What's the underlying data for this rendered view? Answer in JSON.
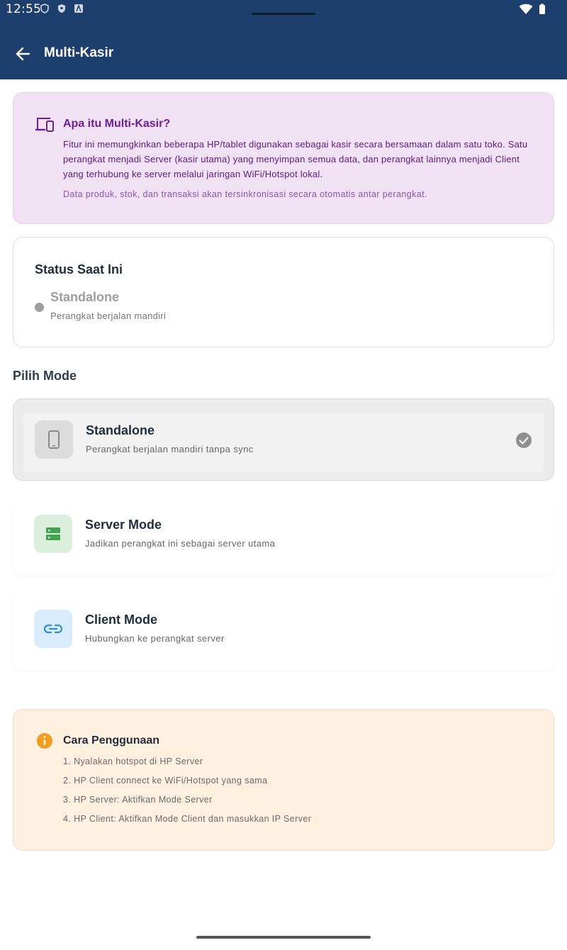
{
  "status_bar": {
    "time": "12:55"
  },
  "app_bar": {
    "title": "Multi-Kasir",
    "back_icon": "arrow-left-icon"
  },
  "info": {
    "icon": "devices-icon",
    "title": "Apa itu Multi-Kasir?",
    "body": "Fitur ini memungkinkan beberapa HP/tablet digunakan sebagai kasir secara bersamaan dalam satu toko. Satu perangkat menjadi Server (kasir utama) yang menyimpan semua data, dan perangkat lainnya menjadi Client yang terhubung ke server melalui jaringan WiFi/Hotspot lokal.",
    "note": "Data produk, stok, dan transaksi akan tersinkronisasi secara otomatis antar perangkat."
  },
  "status": {
    "heading": "Status Saat Ini",
    "value": "Standalone",
    "description": "Perangkat berjalan mandiri"
  },
  "mode_section": {
    "title": "Pilih Mode",
    "modes": [
      {
        "title": "Standalone",
        "description": "Perangkat berjalan mandiri tanpa sync",
        "icon": "phone-icon",
        "selected": true
      },
      {
        "title": "Server Mode",
        "description": "Jadikan perangkat ini sebagai server utama",
        "icon": "server-icon",
        "selected": false
      },
      {
        "title": "Client Mode",
        "description": "Hubungkan ke perangkat server",
        "icon": "link-icon",
        "selected": false
      }
    ]
  },
  "howto": {
    "icon": "info-icon",
    "title": "Cara Penggunaan",
    "steps": [
      "1. Nyalakan hotspot di HP Server",
      "2. HP Client connect ke WiFi/Hotspot yang sama",
      "3. HP Server: Aktifkan Mode Server",
      "4. HP Client: Aktifkan Mode Client dan masukkan IP Server"
    ]
  },
  "colors": {
    "app_bar": "#1c3f6e",
    "info_bg": "#f1e2f3",
    "info_accent": "#6b1f9a",
    "server_accent": "#3fa550",
    "client_accent": "#2f8fd8",
    "howto_bg": "#fff0e0",
    "howto_accent": "#f59c1a"
  }
}
